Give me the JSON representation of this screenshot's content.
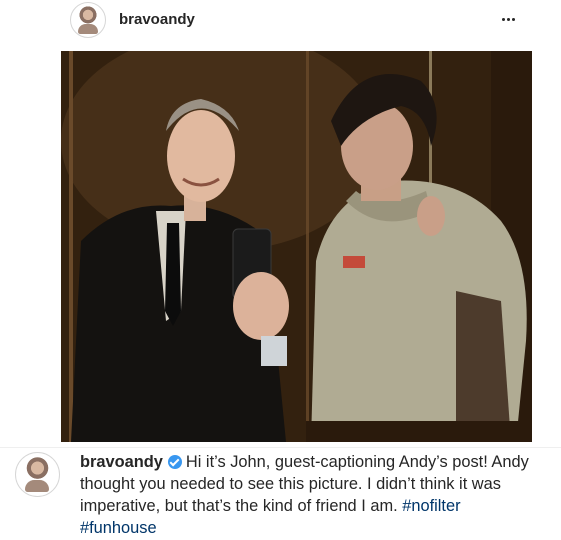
{
  "post": {
    "username": "bravoandy",
    "more_icon": "more-horizontal-icon",
    "photo_alt": "Elevator mirror selfie",
    "caption": {
      "username": "bravoandy",
      "verified_icon": "verified-badge-icon",
      "text": "Hi it’s John, guest-captioning Andy’s post! Andy thought you needed to see this picture. I didn’t think it was imperative, but that’s the kind of friend I am.",
      "hashtags": [
        "#nofilter",
        "#funhouse"
      ]
    },
    "colors": {
      "username": "#262626",
      "verified": "#3897f0",
      "hashtag": "#003569"
    }
  }
}
